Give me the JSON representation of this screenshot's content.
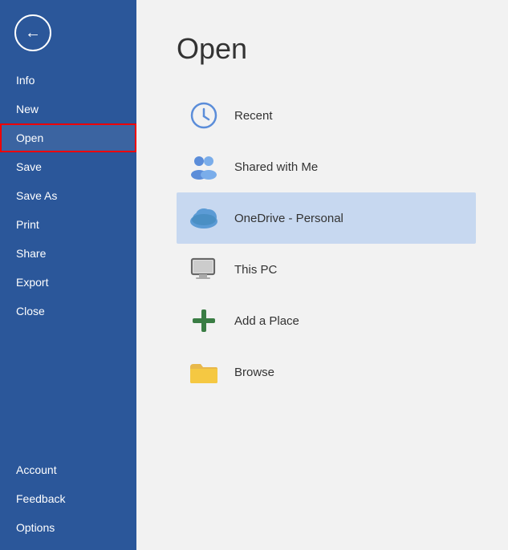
{
  "sidebar": {
    "back_label": "←",
    "items": [
      {
        "id": "info",
        "label": "Info",
        "active": false
      },
      {
        "id": "new",
        "label": "New",
        "active": false
      },
      {
        "id": "open",
        "label": "Open",
        "active": true
      },
      {
        "id": "save",
        "label": "Save",
        "active": false
      },
      {
        "id": "save-as",
        "label": "Save As",
        "active": false
      },
      {
        "id": "print",
        "label": "Print",
        "active": false
      },
      {
        "id": "share",
        "label": "Share",
        "active": false
      },
      {
        "id": "export",
        "label": "Export",
        "active": false
      },
      {
        "id": "close",
        "label": "Close",
        "active": false
      }
    ],
    "bottom_items": [
      {
        "id": "account",
        "label": "Account"
      },
      {
        "id": "feedback",
        "label": "Feedback"
      },
      {
        "id": "options",
        "label": "Options"
      }
    ]
  },
  "main": {
    "title": "Open",
    "locations": [
      {
        "id": "recent",
        "label": "Recent",
        "icon": "clock"
      },
      {
        "id": "shared",
        "label": "Shared with Me",
        "icon": "people"
      },
      {
        "id": "onedrive",
        "label": "OneDrive - Personal",
        "icon": "cloud",
        "selected": true
      },
      {
        "id": "this-pc",
        "label": "This PC",
        "icon": "computer"
      },
      {
        "id": "add-place",
        "label": "Add a Place",
        "icon": "plus"
      },
      {
        "id": "browse",
        "label": "Browse",
        "icon": "folder"
      }
    ]
  }
}
